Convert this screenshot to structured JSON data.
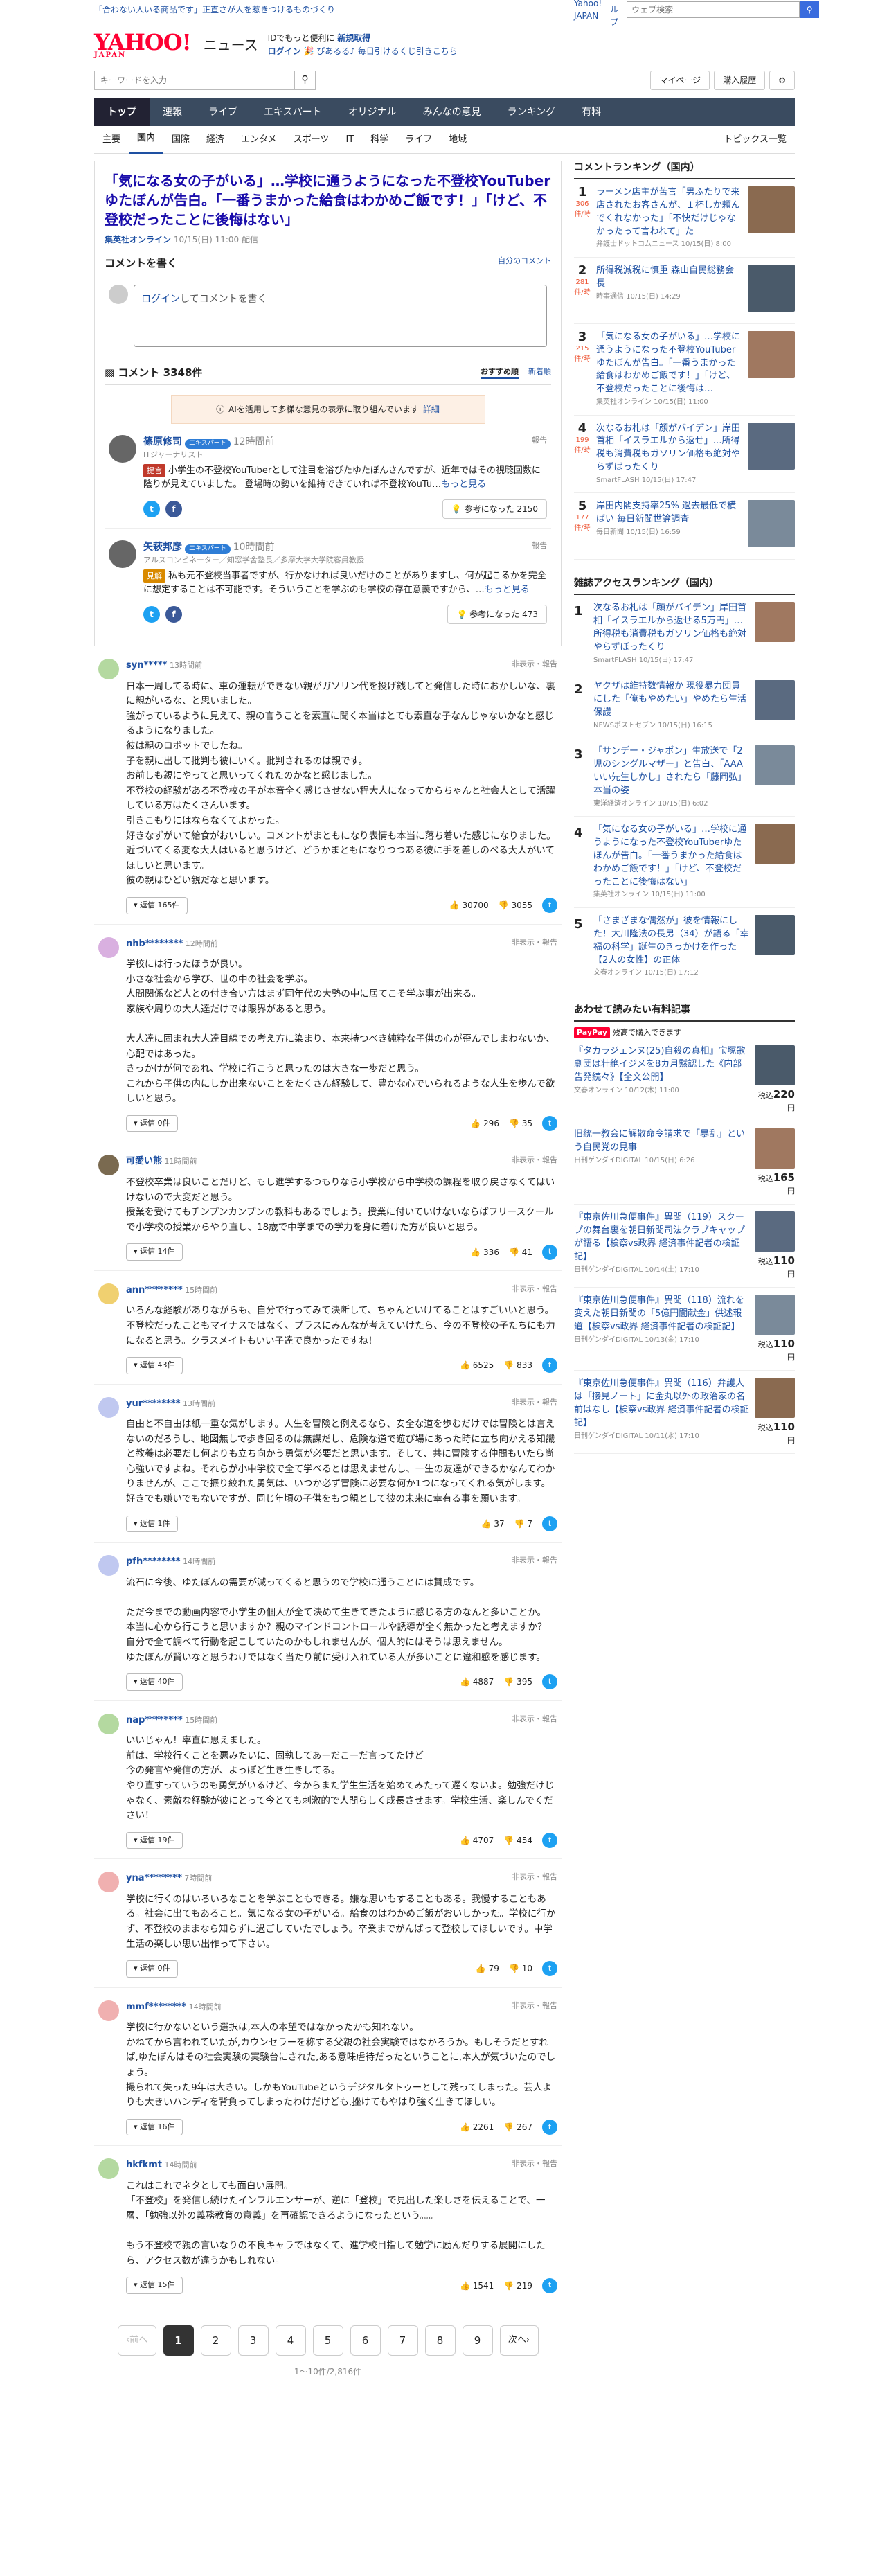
{
  "promo": {
    "text": "「合わない人いる商品です」正直さが人を惹きつけるものづくり",
    "links": [
      "Yahoo! JAPAN",
      "ヘルプ"
    ],
    "search_placeholder": "ウェブ検索"
  },
  "header": {
    "logo": "YAHOO!",
    "logo_sub": "JAPAN",
    "service": "ニュース",
    "line1_prefix": "IDでもっと便利に",
    "line1_link": "新規取得",
    "line2_login": "ログイン",
    "line2_rest": "🎉 ぴあるる♪ 毎日引けるくじ引きこちら"
  },
  "search": {
    "placeholder": "キーワードを入力",
    "mypage": "マイページ",
    "purchase": "購入履歴"
  },
  "nav": [
    "トップ",
    "速報",
    "ライブ",
    "エキスパート",
    "オリジナル",
    "みんなの意見",
    "ランキング",
    "有料"
  ],
  "subnav": [
    "主要",
    "国内",
    "国際",
    "経済",
    "エンタメ",
    "スポーツ",
    "IT",
    "科学",
    "ライフ",
    "地域"
  ],
  "subnav_more": "トピックス一覧",
  "article": {
    "title": "「気になる女の子がいる」…学校に通うようになった不登校YouTuberゆたぼんが告白。「一番うまかった給食はわかめご飯です！」「けど、不登校だったことに後悔はない」",
    "source": "集英社オンライン",
    "date": "10/15(日) 11:00 配信"
  },
  "comment_write": {
    "heading": "コメントを書く",
    "policy": "自分のコメント",
    "login_link": "ログイン",
    "placeholder_rest": "してコメントを書く"
  },
  "comments_header": {
    "title": "コメント 3348件",
    "sort_recommended": "おすすめ順",
    "sort_new": "新着順"
  },
  "ai_bar": {
    "text": "AIを活用して多様な意見の表示に取り組んでいます",
    "detail": "詳細"
  },
  "experts": [
    {
      "name": "篠原修司",
      "badge": "エキスパート",
      "time": "12時間前",
      "sub": "ITジャーナリスト",
      "report": "報告",
      "tag": "提言",
      "tag_color": "#c0392b",
      "text": "小学生の不登校YouTuberとして注目を浴びたゆたぼんさんですが、近年ではその視聴回数に陰りが見えていました。\n登場時の勢いを維持できていれば不登校YouTu…",
      "more": "もっと見る",
      "helpful_label": "参考になった",
      "helpful_count": "2150"
    },
    {
      "name": "矢萩邦彦",
      "badge": "エキスパート",
      "time": "10時間前",
      "sub": "アルスコンビネーター／知窓学舎塾長／多摩大学大学院客員教授",
      "report": "報告",
      "tag": "見解",
      "tag_color": "#d98a00",
      "text": "私も元不登校当事者ですが、行かなければ良いだけのことがありますし、何が起こるかを完全に想定することは不可能です。そういうことを学ぶのも学校の存在意義ですから、…",
      "more": "もっと見る",
      "helpful_label": "参考になった",
      "helpful_count": "473"
    }
  ],
  "comments": [
    {
      "user": "syn*****",
      "time": "13時間前",
      "tools": "非表示・報告",
      "avatar": "#b4d9a0",
      "text": "日本一周してる時に、車の運転ができない親がガソリン代を投げ銭してと発信した時におかしいな、裏に親がいるな、と思いました。\n強がっているように見えて、親の言うことを素直に聞く本当はとても素直な子なんじゃないかなと感じるようになりました。\n彼は親のロボットでしたね。\n子を親に出して批判も彼にいく。批判されるのは親です。\nお前しも親にやってと思いってくれたのかなと感じました。\n不登校の経験がある不登校の子が本音全く感じさせない程大人になってからちゃんと社会人として活躍している方はたくさんいます。\n引きこもりにはならなくてよかった。\n好きなずがいて給食がおいしい。コメントがまともになり表情も本当に落ち着いた感じになりました。\n近づいてくる変な大人はいると思うけど、どうかまともになりつつある彼に手を差しのべる大人がいてほしいと思います。\n彼の親はひどい親だなと思います。",
      "reply": "返信 165件",
      "up": "30700",
      "down": "3055"
    },
    {
      "user": "nhb********",
      "time": "12時間前",
      "tools": "非表示・報告",
      "avatar": "#d9b0e0",
      "text": "学校には行ったほうが良い。\n小さな社会から学び、世の中の社会を学ぶ。\n人間関係など人との付き合い方はまず同年代の大勢の中に居てこそ学ぶ事が出来る。\n家族や周りの大人達だけでは限界があると思う。\n\n大人達に固まれ大人達目線での考え方に染まり、本来持つべき純粋な子供の心が歪んでしまわないか、心配ではあった。\nきっかけが何であれ、学校に行こうと思ったのは大きな一歩だと思う。\nこれから子供の内にしか出来ないことをたくさん経験して、豊かな心でいられるような人生を歩んで欲しいと思う。",
      "reply": "返信 0件",
      "up": "296",
      "down": "35"
    },
    {
      "user": "可愛い熊",
      "time": "11時間前",
      "tools": "非表示・報告",
      "avatar": "#7a6a50",
      "text": "不登校卒業は良いことだけど、もし進学するつもりなら小学校から中学校の課程を取り戻さなくてはいけないので大変だと思う。\n授業を受けてもチンプンカンプンの教科もあるでしょう。授業に付いていけないならばフリースクールで小学校の授業からやり直し、18歳で中学までの学力を身に着けた方が良いと思う。",
      "reply": "返信 14件",
      "up": "336",
      "down": "41"
    },
    {
      "user": "ann********",
      "time": "15時間前",
      "tools": "非表示・報告",
      "avatar": "#f0d070",
      "text": "いろんな経験がありながらも、自分で行ってみて決断して、ちゃんといけてることはすごいいと思う。\n不登校だったこともマイナスではなく、プラスにみんなが考えていけたら、今の不登校の子たちにも力になると思う。クラスメイトもいい子達で良かったですね！",
      "reply": "返信 43件",
      "up": "6525",
      "down": "833"
    },
    {
      "user": "yur********",
      "time": "13時間前",
      "tools": "非表示・報告",
      "avatar": "#c0c8f0",
      "text": "自由と不自由は紙一重な気がします。人生を冒険と例えるなら、安全な道を歩むだけでは冒険とは言えないのだろうし、地図無しで歩き回るのは無謀だし、危険な道で遊び場にあった時に立ち向かえる知識と教養は必要だし何よりも立ち向かう勇気が必要だと思います。そして、共に冒険する仲間もいたら尚心強いですよね。それらが小中学校で全て学べるとは思えませんし、一生の友達ができるかなんてわかりませんが、ここで振り絞れた勇気は、いつか必ず冒険に必要な何か1つになってくれる気がします。好きでも嫌いでもないですが、同じ年頃の子供をもつ親として彼の未来に幸有る事を願います。",
      "reply": "返信 1件",
      "up": "37",
      "down": "7"
    },
    {
      "user": "pfh********",
      "time": "14時間前",
      "tools": "非表示・報告",
      "avatar": "#c0c8f0",
      "text": "流石に今後、ゆたぼんの需要が減ってくると思うので学校に通うことには賛成です。\n\nただ今までの動画内容で小学生の個人が全て決めて生きてきたように感じる方のなんと多いことか。\n本当に心から行こうと思いますか？親のマインドコントロールや誘導が全く無かったと考えますか？\n自分で全て調べて行動を起こしていたのかもしれませんが、個人的にはそうは思えません。\nゆたぼんが賢いなと思うわけではなく当たり前に受け入れている人が多いことに違和感を感じます。",
      "reply": "返信 40件",
      "up": "4887",
      "down": "395"
    },
    {
      "user": "nap********",
      "time": "15時間前",
      "tools": "非表示・報告",
      "avatar": "#b4d9a0",
      "text": "いいじゃん！率直に思えました。\n前は、学校行くことを悪みたいに、固執してあーだこーだ言ってたけど\n今の発言や発信の方が、よっぽど生き生きしてる。\nやり直すっていうのも勇気がいるけど、今からまた学生生活を始めてみたって遅くないよ。勉強だけじゃなく、素敵な経験が彼にとって今とても刺激的で人間らしく成長させます。学校生活、楽しんでください！",
      "reply": "返信 19件",
      "up": "4707",
      "down": "454"
    },
    {
      "user": "yna********",
      "time": "7時間前",
      "tools": "非表示・報告",
      "avatar": "#f0b0b0",
      "text": "学校に行くのはいろいろなことを学ぶこともできる。嫌な思いもすることもある。我慢することもある。社会に出てもあること。気になる女の子がいる。給食のはわかめご飯がおいしかった。学校に行かず、不登校のままなら知らずに過ごしていたでしょう。卒業までがんばって登校してほしいです。中学生活の楽しい思い出作って下さい。",
      "reply": "返信 0件",
      "up": "79",
      "down": "10"
    },
    {
      "user": "mmf********",
      "time": "14時間前",
      "tools": "非表示・報告",
      "avatar": "#f0b0b0",
      "text": "学校に行かないという選択は,本人の本望ではなかったかも知れない。\nかねてから言われていたが,カウンセラーを称する父親の社会実験ではなかろうか。もしそうだとすれば,ゆたぼんはその社会実験の実験台にされた,ある意味虐待だったということに,本人が気づいたのでしょう。\n撮られて失った9年は大きい。しかもYouTubeというデジタルタトゥーとして残ってしまった。芸人よりも大きいハンディを背負ってしまったわけだけども,挫けてもやはり強く生きてほしい。",
      "reply": "返信 16件",
      "up": "2261",
      "down": "267"
    },
    {
      "user": "hkfkmt",
      "time": "14時間前",
      "tools": "非表示・報告",
      "avatar": "#b4d9a0",
      "text": "これはこれでネタとしても面白い展開。\n「不登校」を発信し続けたインフルエンサーが、逆に「登校」で見出した楽しさを伝えることで、一層、「勉強以外の義務教育の意義」を再確認できるようになったという。。。\n\nもう不登校で親の言いなりの不良キャラではなくて、進学校目指して勉学に励んだりする展開にしたら、アクセス数が違うかもしれない。",
      "reply": "返信 15件",
      "up": "1541",
      "down": "219"
    }
  ],
  "pager": {
    "prev": "前へ",
    "pages": [
      "1",
      "2",
      "3",
      "4",
      "5",
      "6",
      "7",
      "8",
      "9"
    ],
    "next": "次へ",
    "count": "1〜10件/2,816件"
  },
  "sidebar": {
    "comment_ranking_title": "コメントランキング（国内）",
    "comment_ranking": [
      {
        "rank": "1",
        "count": "306",
        "unit": "件/時",
        "title": "ラーメン店主が苦言「男ふたりで来店されたお客さんが、１杯しか頼んでくれなかった」「不快だけじゃなかったって言われて」た",
        "meta": "弁護士ドットコムニュース 10/15(日) 8:00"
      },
      {
        "rank": "2",
        "count": "281",
        "unit": "件/時",
        "title": "所得税減税に慎重 森山自民総務会長",
        "meta": "時事通信 10/15(日) 14:29"
      },
      {
        "rank": "3",
        "count": "215",
        "unit": "件/時",
        "title": "「気になる女の子がいる」…学校に通うようになった不登校YouTuberゆたぼんが告白。「一番うまかった給食はわかめご飯です！」「けど、不登校だったことに後悔は…",
        "meta": "集英社オンライン 10/15(日) 11:00"
      },
      {
        "rank": "4",
        "count": "199",
        "unit": "件/時",
        "title": "次なるお札は「顔がバイデン」岸田首相「イスラエルから返せ」…所得税も消費税もガソリン価格も絶対やらずばったくり",
        "meta": "SmartFLASH 10/15(日) 17:47"
      },
      {
        "rank": "5",
        "count": "177",
        "unit": "件/時",
        "title": "岸田内閣支持率25% 過去最低で横ばい 毎日新聞世論調査",
        "meta": "毎日新聞 10/15(日) 16:59"
      }
    ],
    "access_ranking_title": "雑誌アクセスランキング（国内）",
    "access_ranking": [
      {
        "rank": "1",
        "title": "次なるお札は「顔がバイデン」岸田首相「イスラエルから返せる5万円」…所得税も消費税もガソリン価格も絶対やらずぼったくり",
        "meta": "SmartFLASH 10/15(日) 17:47"
      },
      {
        "rank": "2",
        "title": "ヤクザは維持数情報か 現役暴力団員にした「俺もやめたい」やめたら生活保護",
        "meta": "NEWSポストセブン 10/15(日) 16:15"
      },
      {
        "rank": "3",
        "title": "「サンデー・ジャポン」生放送で「2児のシングルマザー」と告白、「AAAいい先生しかし」されたら「藤岡弘」本当の姿",
        "meta": "東洋経済オンライン 10/15(日) 6:02"
      },
      {
        "rank": "4",
        "title": "「気になる女の子がいる」…学校に通うようになった不登校YouTuberゆたぼんが告白。「一番うまかった給食はわかめご飯です！」「けど、不登校だったことに後悔はない」",
        "meta": "集英社オンライン 10/15(日) 11:00"
      },
      {
        "rank": "5",
        "title": "「さまざまな偶然が」彼を情報にした！大川隆法の長男（34）が語る「幸福の科学」誕生のきっかけを作った【2人の女性】の正体",
        "meta": "文春オンライン 10/15(日) 17:12"
      }
    ],
    "sponsored_title": "あわせて読みたい有料記事",
    "paypay_label": "PayPay",
    "paypay_rest": "残高で購入できます",
    "sponsored": [
      {
        "title": "『タカラジェンヌ(25)自殺の真相』宝塚歌劇団は壮絶イジメを8カ月黙認した《内部告発続々》【全文公開】",
        "meta": "文春オンライン 10/12(木) 11:00",
        "price": "220",
        "price_prefix": "税込"
      },
      {
        "title": "旧統一教会に解散命令請求で「暴乱」という自民党の見事",
        "meta": "日刊ゲンダイDIGITAL 10/15(日) 6:26",
        "price": "165",
        "price_prefix": "税込"
      },
      {
        "title": "『東京佐川急便事件』異聞（119）スクープの舞台裏を朝日新聞司法クラブキャップが語る【検察vs政界 経済事件記者の検証記】",
        "meta": "日刊ゲンダイDIGITAL 10/14(土) 17:10",
        "price": "110",
        "price_prefix": "税込"
      },
      {
        "title": "『東京佐川急便事件』異聞（118）流れを変えた朝日新聞の「5億円闇献金」供述報道【検察vs政界 経済事件記者の検証記】",
        "meta": "日刊ゲンダイDIGITAL 10/13(金) 17:10",
        "price": "110",
        "price_prefix": "税込"
      },
      {
        "title": "『東京佐川急便事件』異聞（116）弁護人は「接見ノート」に金丸以外の政治家の名前はなし【検察vs政界 経済事件記者の検証記】",
        "meta": "日刊ゲンダイDIGITAL 10/11(水) 17:10",
        "price": "110",
        "price_prefix": "税込"
      }
    ]
  },
  "colors": {
    "nav": "#3a4b60",
    "link": "#1e50a2",
    "brand": "#ff0033"
  }
}
